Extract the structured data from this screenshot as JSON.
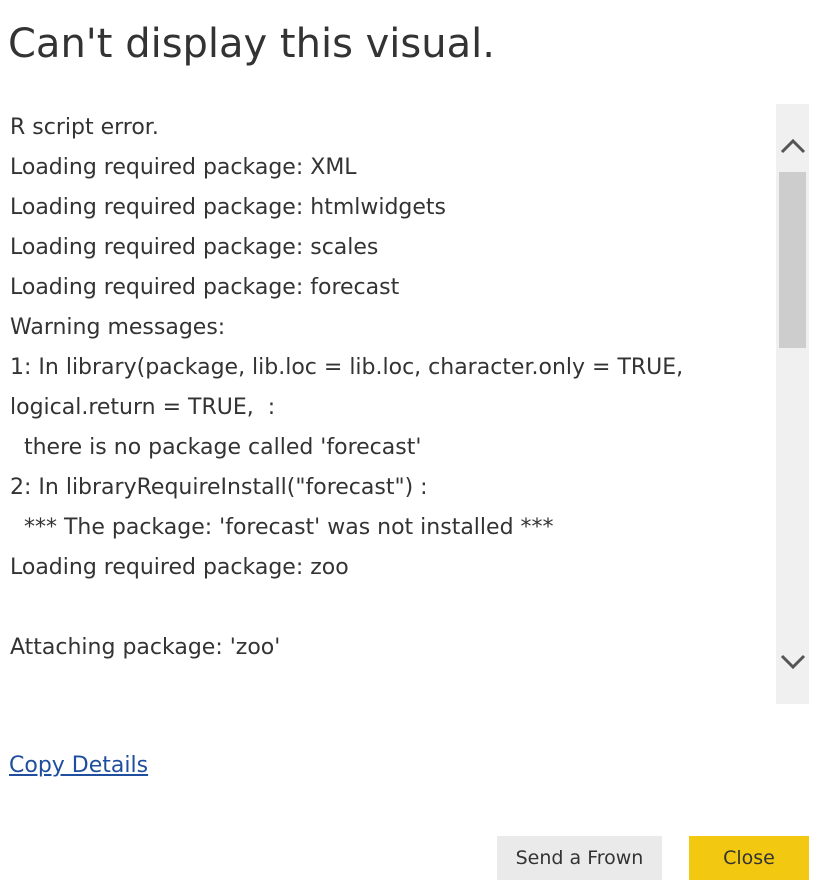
{
  "dialog": {
    "title": "Can't display this visual.",
    "details": {
      "lines": [
        "R script error.",
        "Loading required package: XML",
        "Loading required package: htmlwidgets",
        "Loading required package: scales",
        "Loading required package: forecast",
        "Warning messages:",
        "1: In library(package, lib.loc = lib.loc, character.only = TRUE,",
        "logical.return = TRUE,  :",
        "  there is no package called 'forecast'",
        "2: In libraryRequireInstall(\"forecast\") :",
        "  *** The package: 'forecast' was not installed ***",
        "Loading required package: zoo",
        "",
        "Attaching package: 'zoo'"
      ]
    },
    "scrollbar": {
      "up_icon": "chevron-up-icon",
      "down_icon": "chevron-down-icon"
    },
    "copy_details_label": "Copy Details",
    "buttons": {
      "send_frown_label": "Send a Frown",
      "close_label": "Close"
    },
    "colors": {
      "link": "#1f4e9e",
      "close_button": "#f2c811",
      "secondary_button": "#eaeaea",
      "scrollbar_track": "#f0f0f0",
      "scrollbar_thumb": "#cdcdcd"
    }
  }
}
